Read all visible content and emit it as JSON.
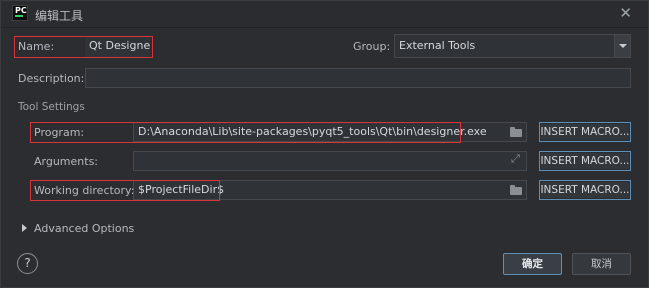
{
  "window": {
    "title": "编辑工具",
    "logo_text": "PC",
    "close_glyph": "✕"
  },
  "form": {
    "name_label": "Name:",
    "name_value": "Qt Designer",
    "group_label": "Group:",
    "group_value": "External Tools",
    "description_label": "Description:",
    "description_value": ""
  },
  "tool_settings": {
    "section_title": "Tool Settings",
    "program_label": "Program:",
    "program_value": "D:\\Anaconda\\Lib\\site-packages\\pyqt5_tools\\Qt\\bin\\designer.exe",
    "arguments_label": "Arguments:",
    "arguments_value": "",
    "working_dir_label": "Working directory:",
    "working_dir_value": "$ProjectFileDir$",
    "insert_macro_label": "INSERT MACRO...",
    "expand_glyph": "⤢"
  },
  "advanced": {
    "label": "Advanced Options"
  },
  "footer": {
    "help_glyph": "?",
    "ok_label": "确定",
    "cancel_label": "取消"
  },
  "colors": {
    "highlight_border": "#d9343a",
    "focus_border": "#5d8fb7",
    "background": "#2b2d30"
  }
}
